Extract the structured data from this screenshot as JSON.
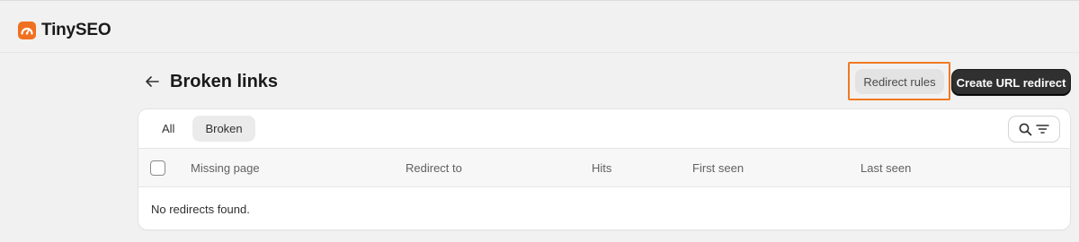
{
  "app": {
    "name": "TinySEO",
    "logo_icon": "orange-gauge-logo",
    "accent": "#f07021"
  },
  "header": {
    "title": "Broken links",
    "back_icon": "arrow-left-icon",
    "secondary_button": "Redirect rules",
    "primary_button": "Create URL redirect"
  },
  "tabs": [
    {
      "label": "All",
      "active": false
    },
    {
      "label": "Broken",
      "active": true
    }
  ],
  "toolbar": {
    "search_icon": "search-icon",
    "filter_icon": "filter-lines-icon"
  },
  "table": {
    "columns": [
      "Missing page",
      "Redirect to",
      "Hits",
      "First seen",
      "Last seen"
    ],
    "empty_message": "No redirects found."
  }
}
